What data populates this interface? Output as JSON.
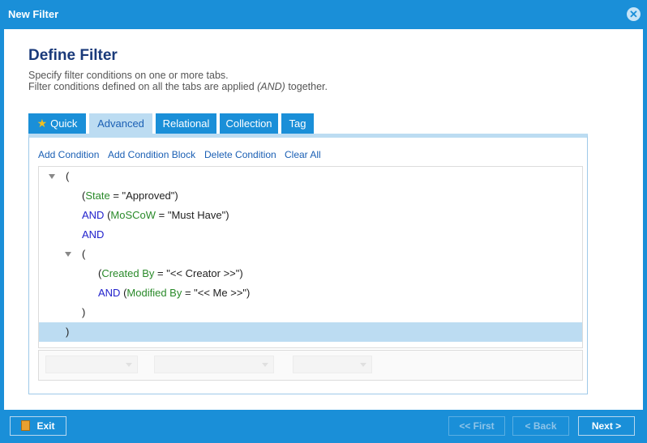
{
  "window": {
    "title": "New Filter",
    "close_icon": "close-icon"
  },
  "header": {
    "heading": "Define Filter",
    "line1": "Specify filter conditions on one or more tabs.",
    "line2_prefix": "Filter conditions defined on all the tabs are applied ",
    "line2_italic": "(AND)",
    "line2_suffix": " together."
  },
  "tabs": [
    {
      "label": "Quick",
      "icon": "star-icon",
      "active": false
    },
    {
      "label": "Advanced",
      "active": true
    },
    {
      "label": "Relational",
      "active": false
    },
    {
      "label": "Collection",
      "active": false
    },
    {
      "label": "Tag",
      "active": false
    }
  ],
  "actions": [
    "Add Condition",
    "Add Condition Block",
    "Delete Condition",
    "Clear All"
  ],
  "tree": {
    "r1": {
      "text": "("
    },
    "r2": {
      "open": "(",
      "field": "State",
      "rest": " = \"Approved\")"
    },
    "r3": {
      "kw": "AND",
      "open": " (",
      "field": "MoSCoW",
      "rest": " = \"Must Have\")"
    },
    "r4": {
      "kw": "AND"
    },
    "r5": {
      "text": "("
    },
    "r6": {
      "open": "(",
      "field": "Created By",
      "rest": " = \"<< Creator >>\")"
    },
    "r7": {
      "kw": "AND",
      "open": " (",
      "field": "Modified By",
      "rest": " = \"<< Me >>\")"
    },
    "r8": {
      "text": ")"
    },
    "r9": {
      "text": ")"
    }
  },
  "footer": {
    "exit": "Exit",
    "first": "<< First",
    "back": "< Back",
    "next": "Next >"
  },
  "colors": {
    "accent": "#1a8fd8",
    "keyword": "#2222cc",
    "field": "#2a8a2a",
    "selected_row": "#bcdcf2"
  }
}
